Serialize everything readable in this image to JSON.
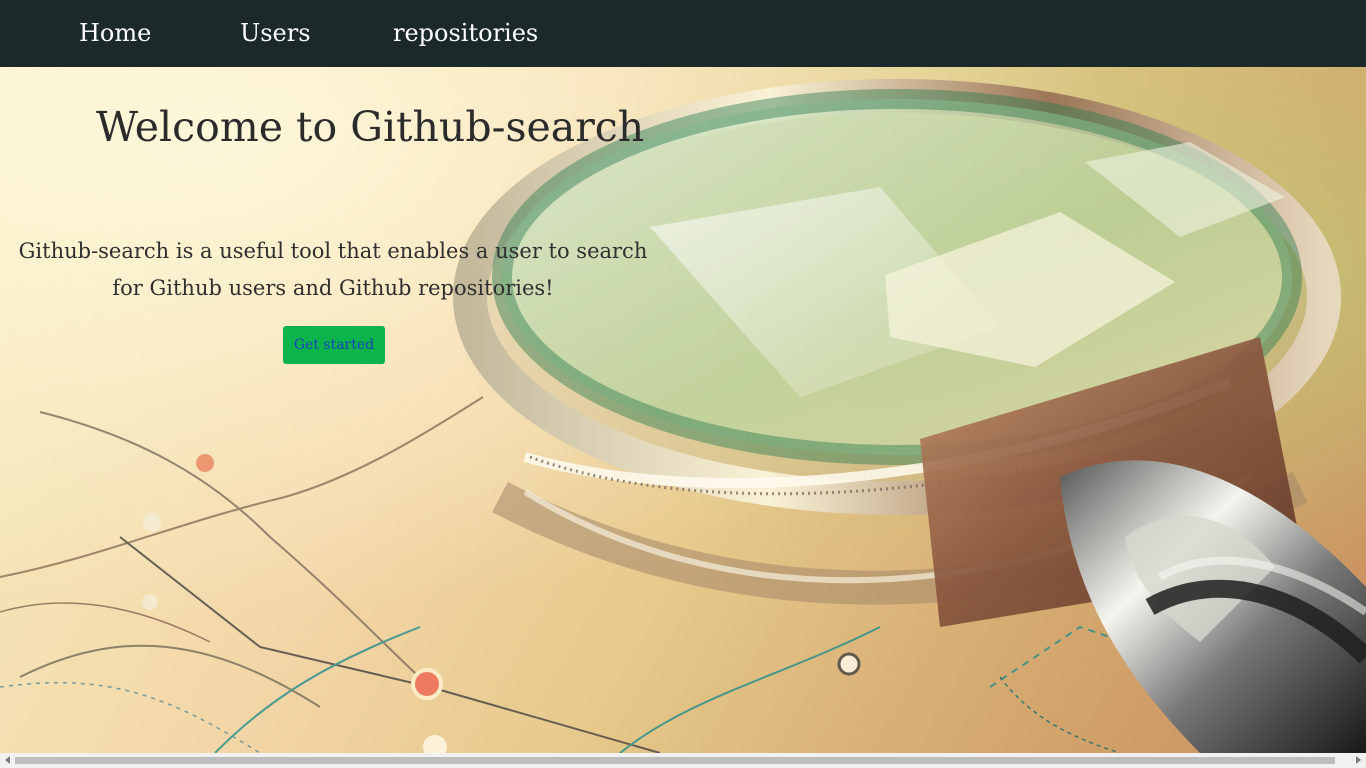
{
  "navigation": {
    "home_label": "Home",
    "users_label": "Users",
    "repositories_label": "repositories"
  },
  "hero": {
    "title": "Welcome to Github-search",
    "description": "Github-search is a useful tool that enables a user to search for Github users and Github repositories!",
    "button_label": "Get started",
    "background_image": "magnifying-glass-on-map"
  },
  "colors": {
    "navbar": "#1b292a",
    "nav_text": "#ffffff",
    "button_background": "#0db44c",
    "button_text": "#1844b7",
    "heading_text": "#2b2b2b"
  },
  "icons": {
    "scroll_left": "scroll-left-arrow-icon",
    "scroll_right": "scroll-right-arrow-icon"
  }
}
